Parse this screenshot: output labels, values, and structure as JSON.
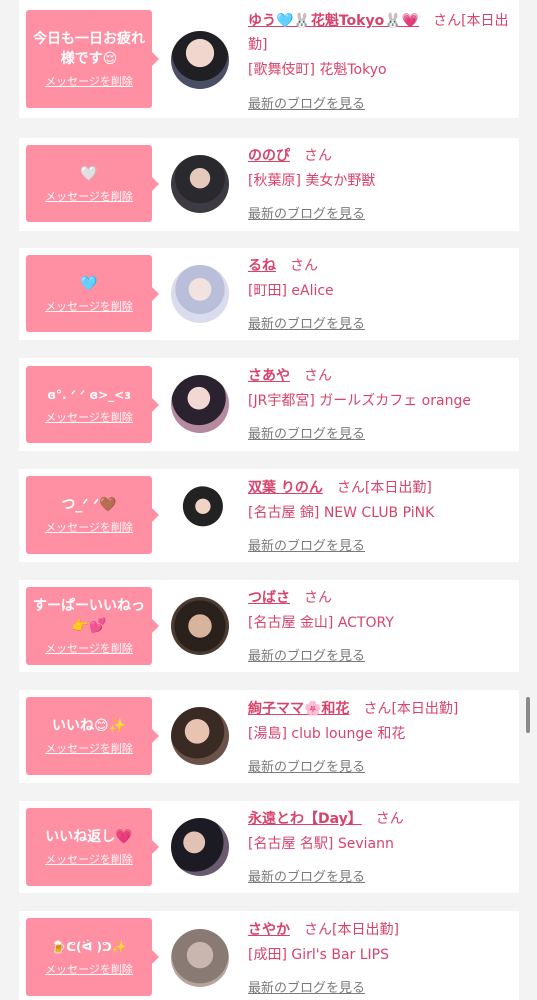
{
  "delete_label": "メッセージを削除",
  "blog_label": "最新のブログを見る",
  "san_label": "さん",
  "accent_color": "#ff8fa3",
  "items": [
    {
      "message": "今日も一日お疲れ様です😌",
      "name": "ゆう🩵🐰花魁Tokyo🐰💗",
      "status": "[本日出勤]",
      "shop": "[歌舞伎町] 花魁Tokyo"
    },
    {
      "message": "🤍",
      "name": "ののぴ",
      "status": "",
      "shop": "[秋葉原] 美女か野獣"
    },
    {
      "message": "🩵",
      "name": "るね",
      "status": "",
      "shop": "[町田] eAlice"
    },
    {
      "message": "ɞ°. ᐟ ᐟ ɞ>_<ɜ",
      "name": "さあや",
      "status": "",
      "shop": "[JR宇都宮] ガールズカフェ orange"
    },
    {
      "message": "つ_ᐟ ᐟ🤎",
      "name": "双葉 りのん",
      "status": "[本日出勤]",
      "shop": "[名古屋 錦] NEW CLUB PiNK"
    },
    {
      "message": "すーぱーいいねっ👉💕",
      "name": "つばさ",
      "status": "",
      "shop": "[名古屋 金山] ACTORY"
    },
    {
      "message": "いいね😊✨",
      "name": "絢子ママ🌸和花",
      "status": "[本日出勤]",
      "shop": "[湯島] club lounge 和花"
    },
    {
      "message": "いいね返し💗",
      "name": "永遠とわ【Day】",
      "status": "",
      "shop": "[名古屋 名駅] Seviann"
    },
    {
      "message": "🍺ᕦ(ᐛ )ᕤ✨",
      "name": "さやか",
      "status": "[本日出勤]",
      "shop": "[成田] Girl's Bar LIPS"
    }
  ]
}
